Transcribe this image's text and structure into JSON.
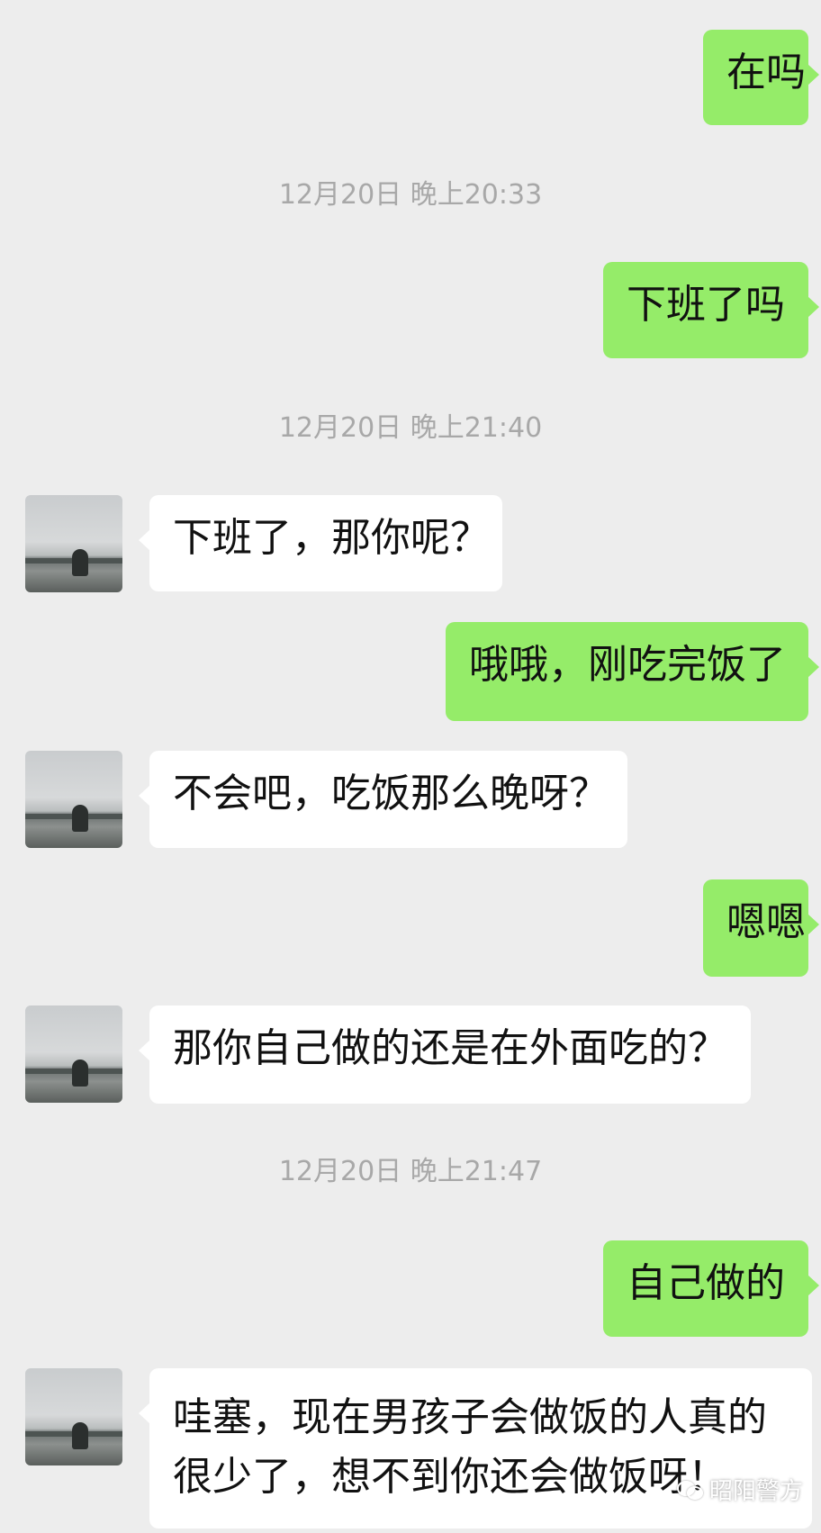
{
  "messages": [
    {
      "side": "sent",
      "text": "在吗"
    },
    {
      "side": "sent",
      "text": "下班了吗"
    },
    {
      "side": "recv",
      "text": "下班了，那你呢？"
    },
    {
      "side": "sent",
      "text": "哦哦，刚吃完饭了"
    },
    {
      "side": "recv",
      "text": "不会吧，吃饭那么晚呀？"
    },
    {
      "side": "sent",
      "text": "嗯嗯"
    },
    {
      "side": "recv",
      "text": "那你自己做的还是在外面吃的？"
    },
    {
      "side": "sent",
      "text": "自己做的"
    },
    {
      "side": "recv",
      "line1": "哇塞，现在男孩子会做饭的人真的",
      "line2": "很少了，想不到你还会做饭呀！"
    }
  ],
  "timestamps": [
    "12月20日 晚上20:33",
    "12月20日 晚上21:40",
    "12月20日 晚上21:47"
  ],
  "watermark": {
    "text": "昭阳警方",
    "icon": "wechat-icon"
  },
  "colors": {
    "background": "#ededed",
    "sent_bubble": "#95ec69",
    "received_bubble": "#ffffff",
    "timestamp_text": "#a8a8a8"
  }
}
